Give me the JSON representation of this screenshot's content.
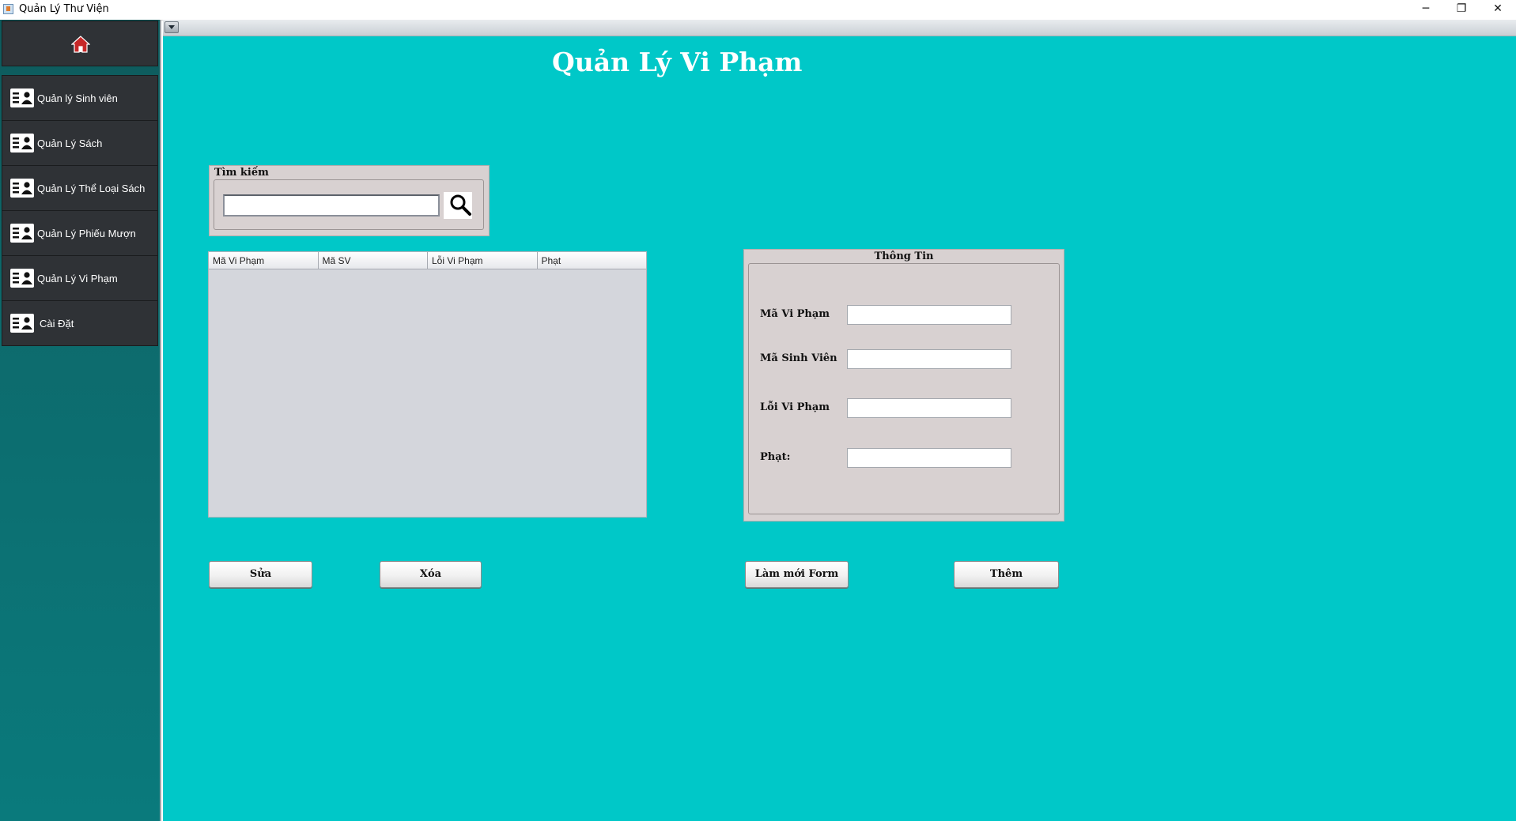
{
  "window": {
    "title": "Quản Lý Thư Viện",
    "controls": {
      "minimize": "─",
      "maximize": "❐",
      "close": "✕"
    }
  },
  "sidebar": {
    "home_icon": "home-icon",
    "items": [
      {
        "label": "Quản lý Sinh viên",
        "icon": "user-card-icon"
      },
      {
        "label": "Quản Lý Sách",
        "icon": "user-card-icon"
      },
      {
        "label": "Quản Lý Thể Loại Sách",
        "icon": "user-card-icon"
      },
      {
        "label": "Quản Lý Phiếu Mượn",
        "icon": "user-card-icon"
      },
      {
        "label": "Quản Lý Vi Phạm",
        "icon": "user-card-icon"
      },
      {
        "label": "Cài Đặt",
        "icon": "user-card-icon"
      }
    ]
  },
  "main": {
    "title": "Quản Lý Vi Phạm",
    "search": {
      "legend": "Tìm kiếm",
      "value": "",
      "placeholder": ""
    },
    "table": {
      "columns": [
        "Mã Vi Phạm",
        "Mã SV",
        "Lỗi Vi Phạm",
        "Phạt"
      ],
      "rows": []
    },
    "info": {
      "legend": "Thông Tin",
      "fields": [
        {
          "label": "Mã Vi Phạm",
          "value": ""
        },
        {
          "label": "Mã Sinh Viên",
          "value": ""
        },
        {
          "label": "Lỗi Vi Phạm",
          "value": ""
        },
        {
          "label": "Phạt:",
          "value": ""
        }
      ]
    },
    "buttons": {
      "edit": "Sửa",
      "delete": "Xóa",
      "reset": "Làm mới Form",
      "add": "Thêm"
    }
  },
  "colors": {
    "main_background": "#00c8c8",
    "sidebar_background": "#0d6b6d",
    "sidebar_item": "#2f3236",
    "group_background": "#d8d1d1",
    "table_background": "#d4d6dc",
    "home_icon": "#c62828"
  }
}
